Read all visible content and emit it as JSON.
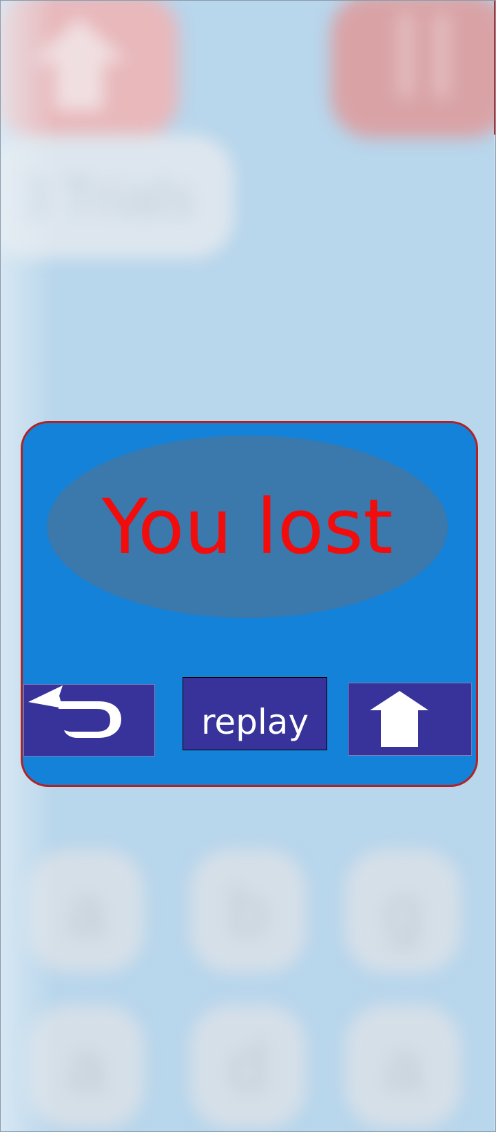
{
  "background": {
    "trials_label": "3 Trials",
    "tiles": [
      "a",
      "b",
      "g",
      "a",
      "d",
      "a"
    ],
    "home_icon": "home-arrow-icon",
    "pause_icon": "pause-icon"
  },
  "dialog": {
    "result_text": "You lost",
    "result_color": "#f20c0c",
    "panel_color": "#1482d9",
    "border_color": "#b22222",
    "button_color": "#37339a",
    "buttons": {
      "back_icon": "undo-arrow-icon",
      "replay_label": "replay",
      "home_icon": "up-arrow-icon"
    }
  }
}
